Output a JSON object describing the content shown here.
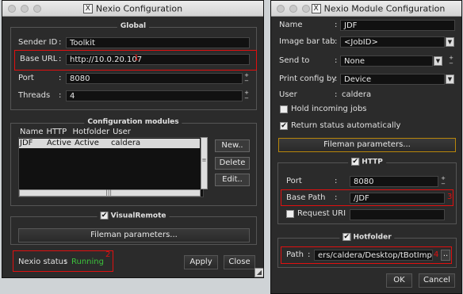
{
  "left_window": {
    "title": "Nexio Configuration",
    "global": {
      "section_title": "Global",
      "sender_id_label": "Sender ID",
      "sender_id_value": "Toolkit",
      "base_url_label": "Base URL",
      "base_url_value": "http://10.0.20.107",
      "port_label": "Port",
      "port_value": "8080",
      "threads_label": "Threads",
      "threads_value": "4"
    },
    "modules": {
      "section_title": "Configuration modules",
      "columns": [
        "Name",
        "HTTP",
        "Hotfolder",
        "User"
      ],
      "rows": [
        [
          "JDF",
          "Active",
          "Active",
          "caldera"
        ]
      ],
      "new_label": "New..",
      "delete_label": "Delete",
      "edit_label": "Edit.."
    },
    "visual_remote": {
      "section_title": "VisualRemote",
      "checkmark": "✔",
      "fileman_label": "Fileman parameters..."
    },
    "status_label": "Nexio status",
    "status_value": "Running",
    "apply_label": "Apply",
    "close_label": "Close",
    "annotations": {
      "a1": "1",
      "a2": "2"
    }
  },
  "right_window": {
    "title": "Nexio Module Configuration",
    "name_label": "Name",
    "name_value": "JDF",
    "image_bar_tab_label": "Image bar tab",
    "image_bar_tab_value": "<JobID>",
    "send_to_label": "Send to",
    "send_to_value": "None",
    "print_config_label": "Print config by",
    "print_config_value": "Device",
    "user_label": "User",
    "user_value": "caldera",
    "hold_jobs_label": "Hold incoming jobs",
    "return_status_label": "Return status automatically",
    "checkmark": "✔",
    "fileman_label": "Fileman parameters...",
    "http": {
      "section_title": "HTTP",
      "port_label": "Port",
      "port_value": "8080",
      "base_path_label": "Base Path",
      "base_path_value": "/JDF",
      "request_uri_label": "Request URI"
    },
    "hotfolder": {
      "section_title": "Hotfolder",
      "path_label": "Path",
      "path_value": "ers/caldera/Desktop/tBotImport"
    },
    "ok_label": "OK",
    "cancel_label": "Cancel",
    "annotations": {
      "a3": "3",
      "a4": "4"
    }
  },
  "colors": {
    "accent_red": "#e01010",
    "running_green": "#3cc23c",
    "window_bg": "#2b2b2b"
  }
}
